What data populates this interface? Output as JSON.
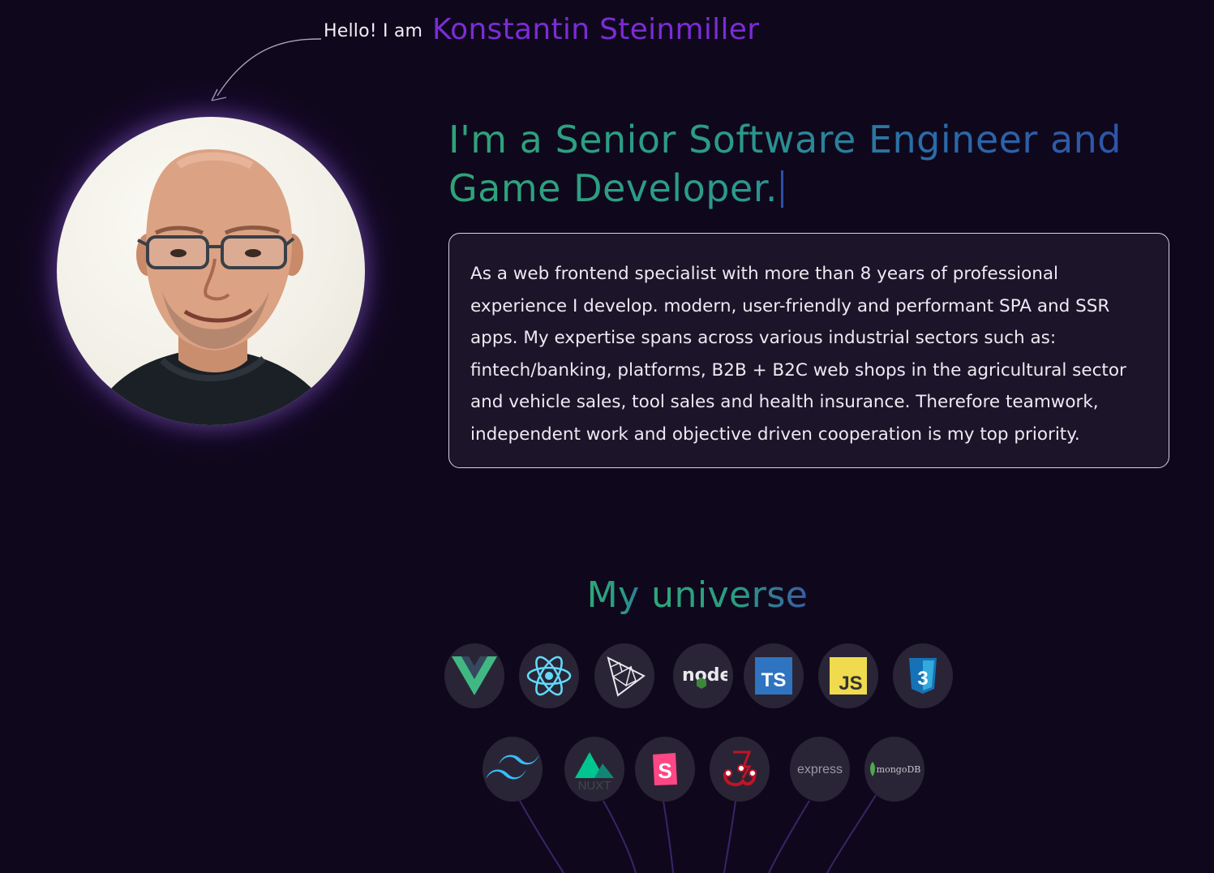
{
  "intro": {
    "greeting": "Hello! I am",
    "name": "Konstantin Steinmiller"
  },
  "headline": {
    "line1": "I'm a Senior Software Engineer and",
    "line2": "Game Developer."
  },
  "about": {
    "text": "As a web frontend specialist with more than 8 years of professional experience I develop. modern, user-friendly and performant SPA and SSR apps. My expertise spans across various industrial sectors such as: fintech/banking, platforms, B2B + B2C web shops in the agricultural sector and vehicle sales, tool sales and health insurance. Therefore teamwork, independent work and objective driven cooperation is my top priority."
  },
  "universe": {
    "title_part1": "My ",
    "title_part2": "universe",
    "tech_row1": [
      {
        "name": "vue-icon"
      },
      {
        "name": "react-icon"
      },
      {
        "name": "threejs-icon"
      },
      {
        "name": "nodejs-icon",
        "label": "node"
      },
      {
        "name": "typescript-icon",
        "label": "TS"
      },
      {
        "name": "javascript-icon",
        "label": "JS"
      },
      {
        "name": "css3-icon",
        "label": "3"
      }
    ],
    "tech_row2": [
      {
        "name": "tailwind-icon"
      },
      {
        "name": "nuxt-icon",
        "label": "NUXT"
      },
      {
        "name": "storybook-icon",
        "label": "S"
      },
      {
        "name": "jest-icon"
      },
      {
        "name": "express-icon",
        "label": "express"
      },
      {
        "name": "mongodb-icon",
        "label": "mongoDB"
      }
    ]
  },
  "colors": {
    "background": "#0f081c",
    "name_purple": "#7b2cd6",
    "headline_green": "#2fa37a",
    "headline_blue": "#2f4fa8",
    "box_bg": "#1c1428",
    "tech_circle": "#2a2536"
  }
}
